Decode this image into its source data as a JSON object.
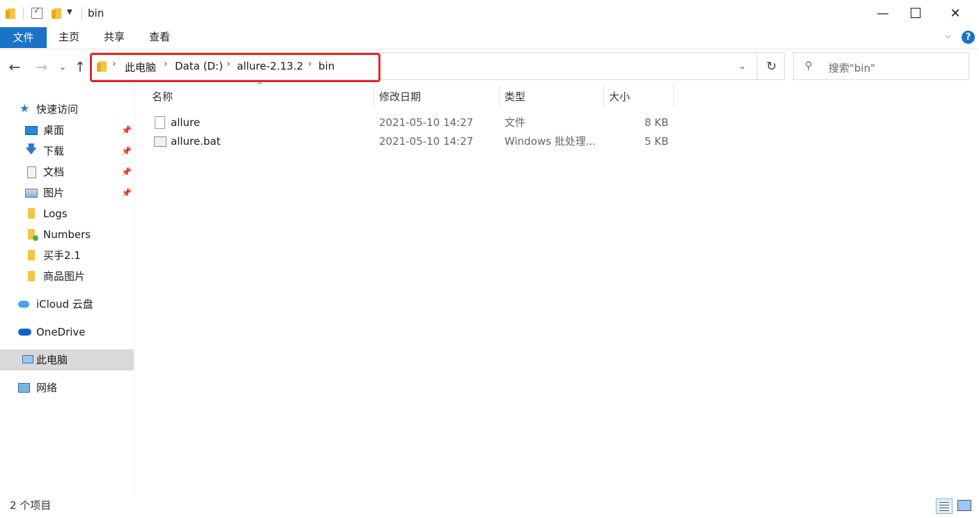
{
  "window": {
    "title": "bin",
    "controls": {
      "minimize": "—",
      "maximize": "☐",
      "close": "✕"
    }
  },
  "ribbon": {
    "tabs": [
      "文件",
      "主页",
      "共享",
      "查看"
    ],
    "active_color": "#1a73c8",
    "help_icon": "?"
  },
  "address": {
    "crumbs": [
      "此电脑",
      "Data (D:)",
      "allure-2.13.2",
      "bin"
    ],
    "highlight_color": "#e5252a"
  },
  "search": {
    "placeholder": "搜索\"bin\""
  },
  "sidebar": {
    "quick_access": "快速访问",
    "pinned": [
      "桌面",
      "下载",
      "文档",
      "图片"
    ],
    "folders": [
      "Logs",
      "Numbers",
      "买手2.1",
      "商品图片"
    ],
    "icloud": "iCloud 云盘",
    "onedrive": "OneDrive",
    "this_pc": "此电脑",
    "network": "网络"
  },
  "columns": {
    "name": "名称",
    "date": "修改日期",
    "type": "类型",
    "size": "大小"
  },
  "files": [
    {
      "name": "allure",
      "date": "2021-05-10 14:27",
      "type": "文件",
      "size": "8 KB"
    },
    {
      "name": "allure.bat",
      "date": "2021-05-10 14:27",
      "type": "Windows 批处理...",
      "size": "5 KB"
    }
  ],
  "status": {
    "item_count": "2 个项目"
  }
}
